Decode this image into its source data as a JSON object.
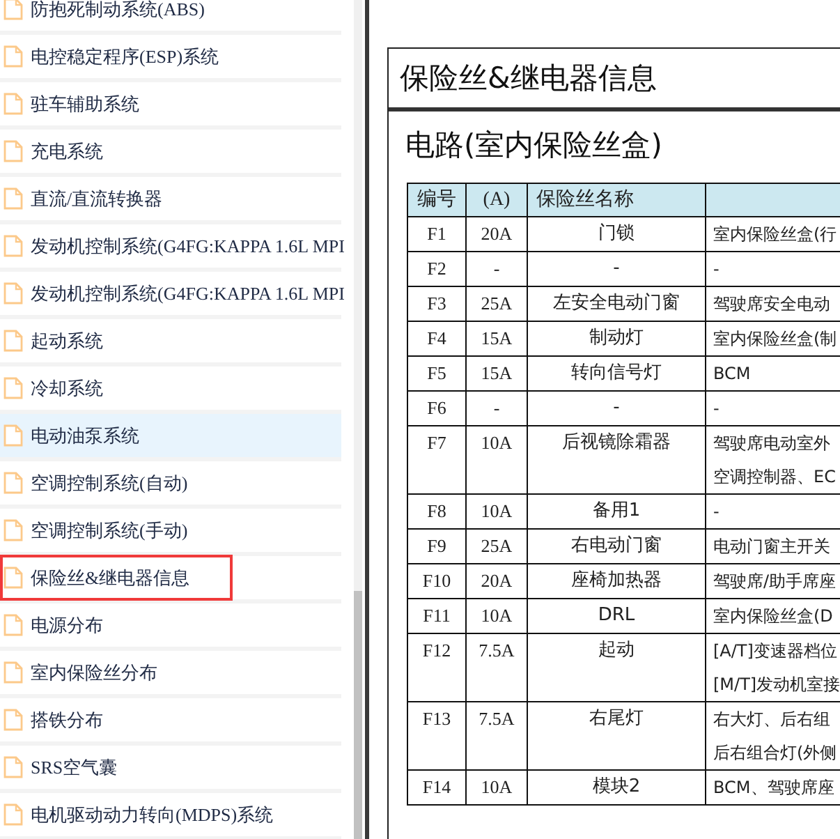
{
  "sidebar": {
    "items": [
      {
        "label": "防抱死制动系统(ABS)",
        "selected": false,
        "highlighted": false
      },
      {
        "label": "电控稳定程序(ESP)系统",
        "selected": false,
        "highlighted": false
      },
      {
        "label": "驻车辅助系统",
        "selected": false,
        "highlighted": false
      },
      {
        "label": "充电系统",
        "selected": false,
        "highlighted": false
      },
      {
        "label": "直流/直流转换器",
        "selected": false,
        "highlighted": false
      },
      {
        "label": "发动机控制系统(G4FG:KAPPA 1.6L MPI",
        "selected": false,
        "highlighted": false
      },
      {
        "label": "发动机控制系统(G4FG:KAPPA 1.6L MPI",
        "selected": false,
        "highlighted": false
      },
      {
        "label": "起动系统",
        "selected": false,
        "highlighted": false
      },
      {
        "label": "冷却系统",
        "selected": false,
        "highlighted": false
      },
      {
        "label": "电动油泵系统",
        "selected": true,
        "highlighted": false
      },
      {
        "label": "空调控制系统(自动)",
        "selected": false,
        "highlighted": false
      },
      {
        "label": "空调控制系统(手动)",
        "selected": false,
        "highlighted": false
      },
      {
        "label": "保险丝&继电器信息",
        "selected": false,
        "highlighted": true
      },
      {
        "label": "电源分布",
        "selected": false,
        "highlighted": false
      },
      {
        "label": "室内保险丝分布",
        "selected": false,
        "highlighted": false
      },
      {
        "label": "搭铁分布",
        "selected": false,
        "highlighted": false
      },
      {
        "label": "SRS空气囊",
        "selected": false,
        "highlighted": false
      },
      {
        "label": "电机驱动动力转向(MDPS)系统",
        "selected": false,
        "highlighted": false
      }
    ]
  },
  "document": {
    "title": "保险丝&继电器信息",
    "heading": "电路(室内保险丝盒)",
    "table": {
      "columns": [
        "编号",
        "(A)",
        "保险丝名称"
      ],
      "rows": [
        {
          "id": "F1",
          "amp": "20A",
          "name": "门锁",
          "circuit": [
            "室内保险丝盒(行"
          ]
        },
        {
          "id": "F2",
          "amp": "-",
          "name": "-",
          "circuit": [
            "-"
          ]
        },
        {
          "id": "F3",
          "amp": "25A",
          "name": "左安全电动门窗",
          "circuit": [
            "驾驶席安全电动"
          ]
        },
        {
          "id": "F4",
          "amp": "15A",
          "name": "制动灯",
          "circuit": [
            "室内保险丝盒(制"
          ]
        },
        {
          "id": "F5",
          "amp": "15A",
          "name": "转向信号灯",
          "circuit": [
            "BCM"
          ]
        },
        {
          "id": "F6",
          "amp": "-",
          "name": "-",
          "circuit": [
            "-"
          ]
        },
        {
          "id": "F7",
          "amp": "10A",
          "name": "后视镜除霜器",
          "circuit": [
            "驾驶席电动室外",
            "空调控制器、EC"
          ]
        },
        {
          "id": "F8",
          "amp": "10A",
          "name": "备用1",
          "circuit": [
            "-"
          ]
        },
        {
          "id": "F9",
          "amp": "25A",
          "name": "右电动门窗",
          "circuit": [
            "电动门窗主开关"
          ]
        },
        {
          "id": "F10",
          "amp": "20A",
          "name": "座椅加热器",
          "circuit": [
            "驾驶席/助手席座"
          ]
        },
        {
          "id": "F11",
          "amp": "10A",
          "name": "DRL",
          "circuit": [
            "室内保险丝盒(D"
          ]
        },
        {
          "id": "F12",
          "amp": "7.5A",
          "name": "起动",
          "circuit": [
            "[A/T]变速器档位",
            "[M/T]发动机室接"
          ]
        },
        {
          "id": "F13",
          "amp": "7.5A",
          "name": "右尾灯",
          "circuit": [
            "右大灯、后右组",
            "后右组合灯(外侧"
          ]
        },
        {
          "id": "F14",
          "amp": "10A",
          "name": "模块2",
          "circuit": [
            "BCM、驾驶席座"
          ]
        }
      ]
    }
  }
}
